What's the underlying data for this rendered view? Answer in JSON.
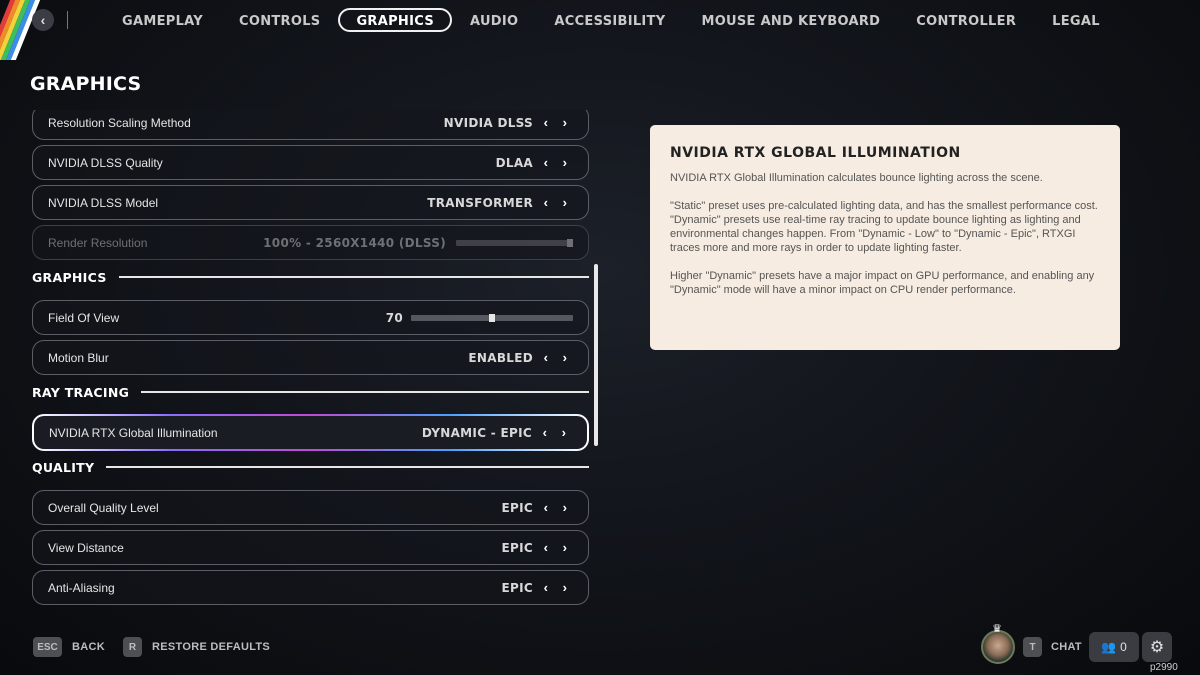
{
  "nav": {
    "back_icon": "chevron-left-icon",
    "tabs": [
      {
        "label": "GAMEPLAY",
        "active": false
      },
      {
        "label": "CONTROLS",
        "active": false
      },
      {
        "label": "GRAPHICS",
        "active": true
      },
      {
        "label": "AUDIO",
        "active": false
      },
      {
        "label": "ACCESSIBILITY",
        "active": false
      },
      {
        "label": "MOUSE AND KEYBOARD",
        "active": false
      },
      {
        "label": "CONTROLLER",
        "active": false
      },
      {
        "label": "LEGAL",
        "active": false
      }
    ]
  },
  "page_title": "GRAPHICS",
  "settings": {
    "rows": [
      {
        "label": "Resolution Scaling Method",
        "value": "NVIDIA DLSS"
      },
      {
        "label": "NVIDIA DLSS Quality",
        "value": "DLAA"
      },
      {
        "label": "NVIDIA DLSS Model",
        "value": "TRANSFORMER"
      },
      {
        "label": "Render Resolution",
        "value": "100% - 2560X1440 (DLSS)",
        "disabled": true,
        "slider_level": 1.0
      },
      {
        "label": "Field Of View",
        "value": "70",
        "slider_level": 0.5
      },
      {
        "label": "Motion Blur",
        "value": "ENABLED"
      },
      {
        "label": "NVIDIA RTX Global Illumination",
        "value": "DYNAMIC - EPIC",
        "selected": true
      },
      {
        "label": "Overall Quality Level",
        "value": "EPIC"
      },
      {
        "label": "View Distance",
        "value": "EPIC"
      },
      {
        "label": "Anti-Aliasing",
        "value": "EPIC"
      }
    ],
    "sections": [
      "GRAPHICS",
      "RAY TRACING",
      "QUALITY"
    ]
  },
  "info": {
    "title": "NVIDIA RTX GLOBAL ILLUMINATION",
    "p1": "NVIDIA RTX Global Illumination calculates bounce lighting across the scene.",
    "p2": "\"Static\" preset uses pre-calculated lighting data, and has the smallest performance cost.",
    "p3": "\"Dynamic\" presets use real-time ray tracing to update bounce lighting as lighting and environmental changes happen. From \"Dynamic - Low\" to \"Dynamic - Epic\", RTXGI traces more and more rays in order to update lighting faster.",
    "p4": "Higher \"Dynamic\" presets have a major impact on GPU performance, and enabling any \"Dynamic\" mode will have a minor impact on CPU render performance."
  },
  "bottom": {
    "back_key": "ESC",
    "back_label": "BACK",
    "restore_key": "R",
    "restore_label": "RESTORE DEFAULTS",
    "chat_key": "T",
    "chat_label": "CHAT",
    "friends_count": "0",
    "player_id": "p2990"
  },
  "colors": {
    "accent_border": "#f0f0f0",
    "info_bg": "#f6ece2",
    "highlight_gradient": [
      "#8a6cff",
      "#c04bd0",
      "#4aa0ff"
    ]
  }
}
